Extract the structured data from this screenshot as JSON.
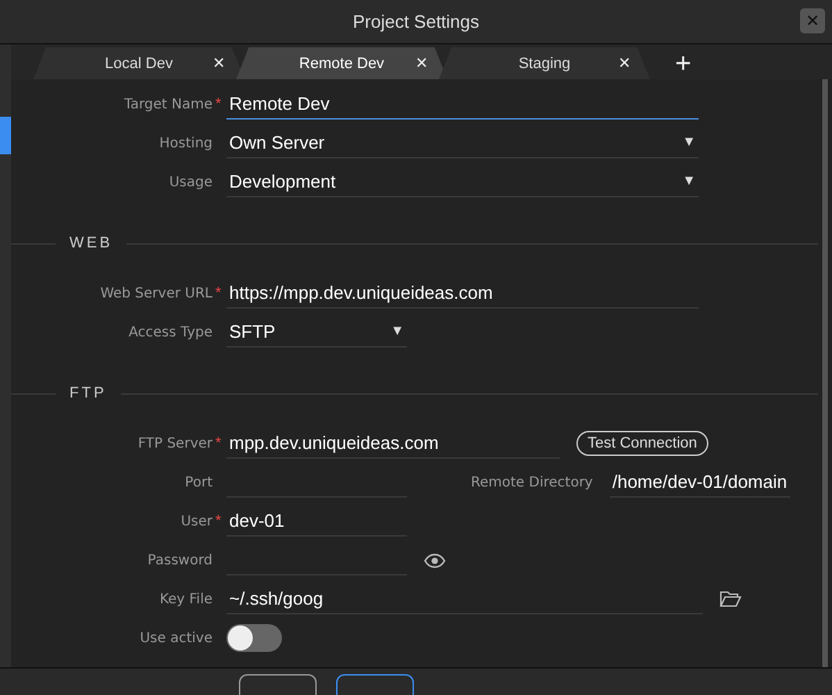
{
  "window": {
    "title": "Project Settings",
    "close": "✕"
  },
  "tabs": [
    {
      "label": "Local Dev",
      "close": "✕",
      "selected": false
    },
    {
      "label": "Remote Dev",
      "close": "✕",
      "selected": true
    },
    {
      "label": "Staging",
      "close": "✕",
      "selected": false
    }
  ],
  "add_tab": "+",
  "sections": [
    {
      "fields": [
        {
          "kind": "text",
          "label": "Target Name",
          "required_mark": "*",
          "value": "Remote Dev",
          "focused": true
        },
        {
          "kind": "select",
          "label": "Hosting",
          "value": "Own Server",
          "caret": "▼"
        },
        {
          "kind": "select",
          "label": "Usage",
          "value": "Development",
          "caret": "▼"
        }
      ]
    },
    {
      "heading": "WEB",
      "fields": [
        {
          "kind": "text",
          "label": "Web Server URL",
          "required_mark": "*",
          "value": "https://mpp.dev.uniqueideas.com",
          "focused": false
        },
        {
          "kind": "short-select",
          "label": "Access Type",
          "value": "SFTP",
          "caret": "▼"
        }
      ]
    },
    {
      "heading": "FTP",
      "fields": [
        {
          "kind": "text-button",
          "label": "FTP Server",
          "required_mark": "*",
          "value": "mpp.dev.uniqueideas.com",
          "button": "Test Connection"
        },
        {
          "kind": "pair",
          "label": "Port",
          "second_label": "Remote Directory",
          "second_value": "/home/dev-01/domain"
        },
        {
          "kind": "short-text",
          "label": "User",
          "required_mark": "*",
          "value": "dev-01"
        },
        {
          "kind": "password",
          "label": "Password"
        },
        {
          "kind": "file",
          "label": "Key File",
          "value": "~/.ssh/goog"
        },
        {
          "kind": "toggle",
          "label": "Use active",
          "on": false
        }
      ]
    }
  ]
}
